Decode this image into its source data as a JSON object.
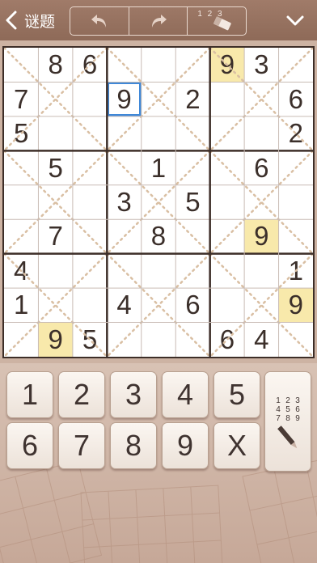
{
  "header": {
    "back_label": "谜题",
    "eraser_digits": "1 2 3"
  },
  "board": {
    "givens": [
      {
        "r": 0,
        "c": 1,
        "v": "8"
      },
      {
        "r": 0,
        "c": 2,
        "v": "6"
      },
      {
        "r": 0,
        "c": 6,
        "v": "9"
      },
      {
        "r": 0,
        "c": 7,
        "v": "3"
      },
      {
        "r": 1,
        "c": 0,
        "v": "7"
      },
      {
        "r": 1,
        "c": 3,
        "v": "9"
      },
      {
        "r": 1,
        "c": 5,
        "v": "2"
      },
      {
        "r": 1,
        "c": 8,
        "v": "6"
      },
      {
        "r": 2,
        "c": 0,
        "v": "5"
      },
      {
        "r": 2,
        "c": 8,
        "v": "2"
      },
      {
        "r": 3,
        "c": 1,
        "v": "5"
      },
      {
        "r": 3,
        "c": 4,
        "v": "1"
      },
      {
        "r": 3,
        "c": 7,
        "v": "6"
      },
      {
        "r": 4,
        "c": 3,
        "v": "3"
      },
      {
        "r": 4,
        "c": 5,
        "v": "5"
      },
      {
        "r": 5,
        "c": 1,
        "v": "7"
      },
      {
        "r": 5,
        "c": 4,
        "v": "8"
      },
      {
        "r": 5,
        "c": 7,
        "v": "9"
      },
      {
        "r": 6,
        "c": 0,
        "v": "4"
      },
      {
        "r": 6,
        "c": 8,
        "v": "1"
      },
      {
        "r": 7,
        "c": 0,
        "v": "1"
      },
      {
        "r": 7,
        "c": 3,
        "v": "4"
      },
      {
        "r": 7,
        "c": 5,
        "v": "6"
      },
      {
        "r": 7,
        "c": 8,
        "v": "9"
      },
      {
        "r": 8,
        "c": 1,
        "v": "9"
      },
      {
        "r": 8,
        "c": 2,
        "v": "5"
      },
      {
        "r": 8,
        "c": 6,
        "v": "6"
      },
      {
        "r": 8,
        "c": 7,
        "v": "4"
      }
    ],
    "highlighted_digit": "9",
    "selected": {
      "r": 1,
      "c": 3
    }
  },
  "keypad": {
    "keys": [
      "1",
      "2",
      "3",
      "4",
      "5",
      "6",
      "7",
      "8",
      "9",
      "X"
    ],
    "note_digits": [
      "1",
      "2",
      "3",
      "4",
      "5",
      "6",
      "7",
      "8",
      "9"
    ]
  },
  "colors": {
    "header": "#9a7563",
    "highlight": "#f8e9ab",
    "selection": "#3f88d8",
    "grid_thick": "#3d2e28",
    "diagonal_dots": "#d9bfa3"
  }
}
